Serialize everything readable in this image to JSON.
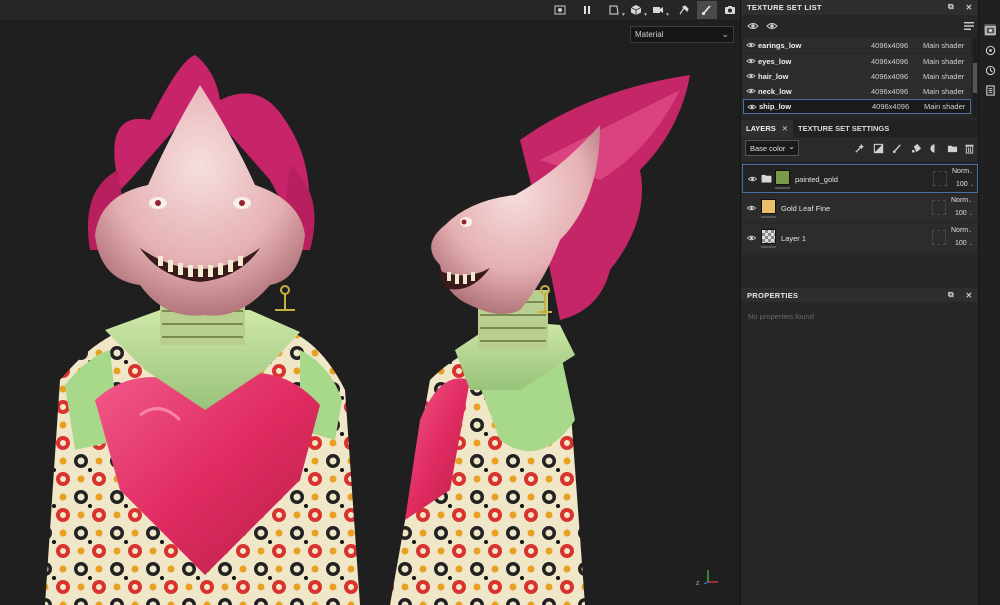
{
  "toolbar": {
    "icons": [
      "screenshot-icon",
      "pause-icon",
      "frame-icon",
      "cube-icon",
      "video-camera-icon",
      "paint-roller-icon",
      "brush-icon",
      "camera-icon"
    ],
    "active": "brush-icon"
  },
  "viewport": {
    "material_select": "Material"
  },
  "texture_set_list": {
    "title": "TEXTURE SET LIST",
    "rows": [
      {
        "name": "earings_low",
        "resolution": "4096x4096",
        "shader": "Main shader",
        "selected": false
      },
      {
        "name": "eyes_low",
        "resolution": "4096x4096",
        "shader": "Main shader",
        "selected": false
      },
      {
        "name": "hair_low",
        "resolution": "4096x4096",
        "shader": "Main shader",
        "selected": false
      },
      {
        "name": "neck_low",
        "resolution": "4096x4096",
        "shader": "Main shader",
        "selected": false
      },
      {
        "name": "ship_low",
        "resolution": "4096x4096",
        "shader": "Main shader",
        "selected": true
      }
    ]
  },
  "layers_panel": {
    "tabs": [
      {
        "label": "LAYERS",
        "active": true,
        "closable": true
      },
      {
        "label": "TEXTURE SET SETTINGS",
        "active": false,
        "closable": false
      }
    ],
    "channel": "Base color",
    "layers": [
      {
        "name": "painted_gold",
        "blend": "Norm",
        "opacity": "100",
        "type": "folder",
        "thumb_color": "#7a9a4a",
        "selected": true
      },
      {
        "name": "Gold Leaf Fine",
        "blend": "Norm",
        "opacity": "100",
        "type": "fill",
        "thumb_color": "#e8c06a",
        "selected": false
      },
      {
        "name": "Layer 1",
        "blend": "Norm",
        "opacity": "100",
        "type": "paint",
        "thumb_color": "checker",
        "selected": false
      }
    ]
  },
  "properties": {
    "title": "PROPERTIES",
    "empty_text": "No properties found"
  },
  "colors": {
    "accent_selected": "#4a6fa5",
    "hair_pink": "#d6306e",
    "skin": "#e8b8b8",
    "robe_red": "#e8336b",
    "robe_green": "#a8d88a"
  }
}
